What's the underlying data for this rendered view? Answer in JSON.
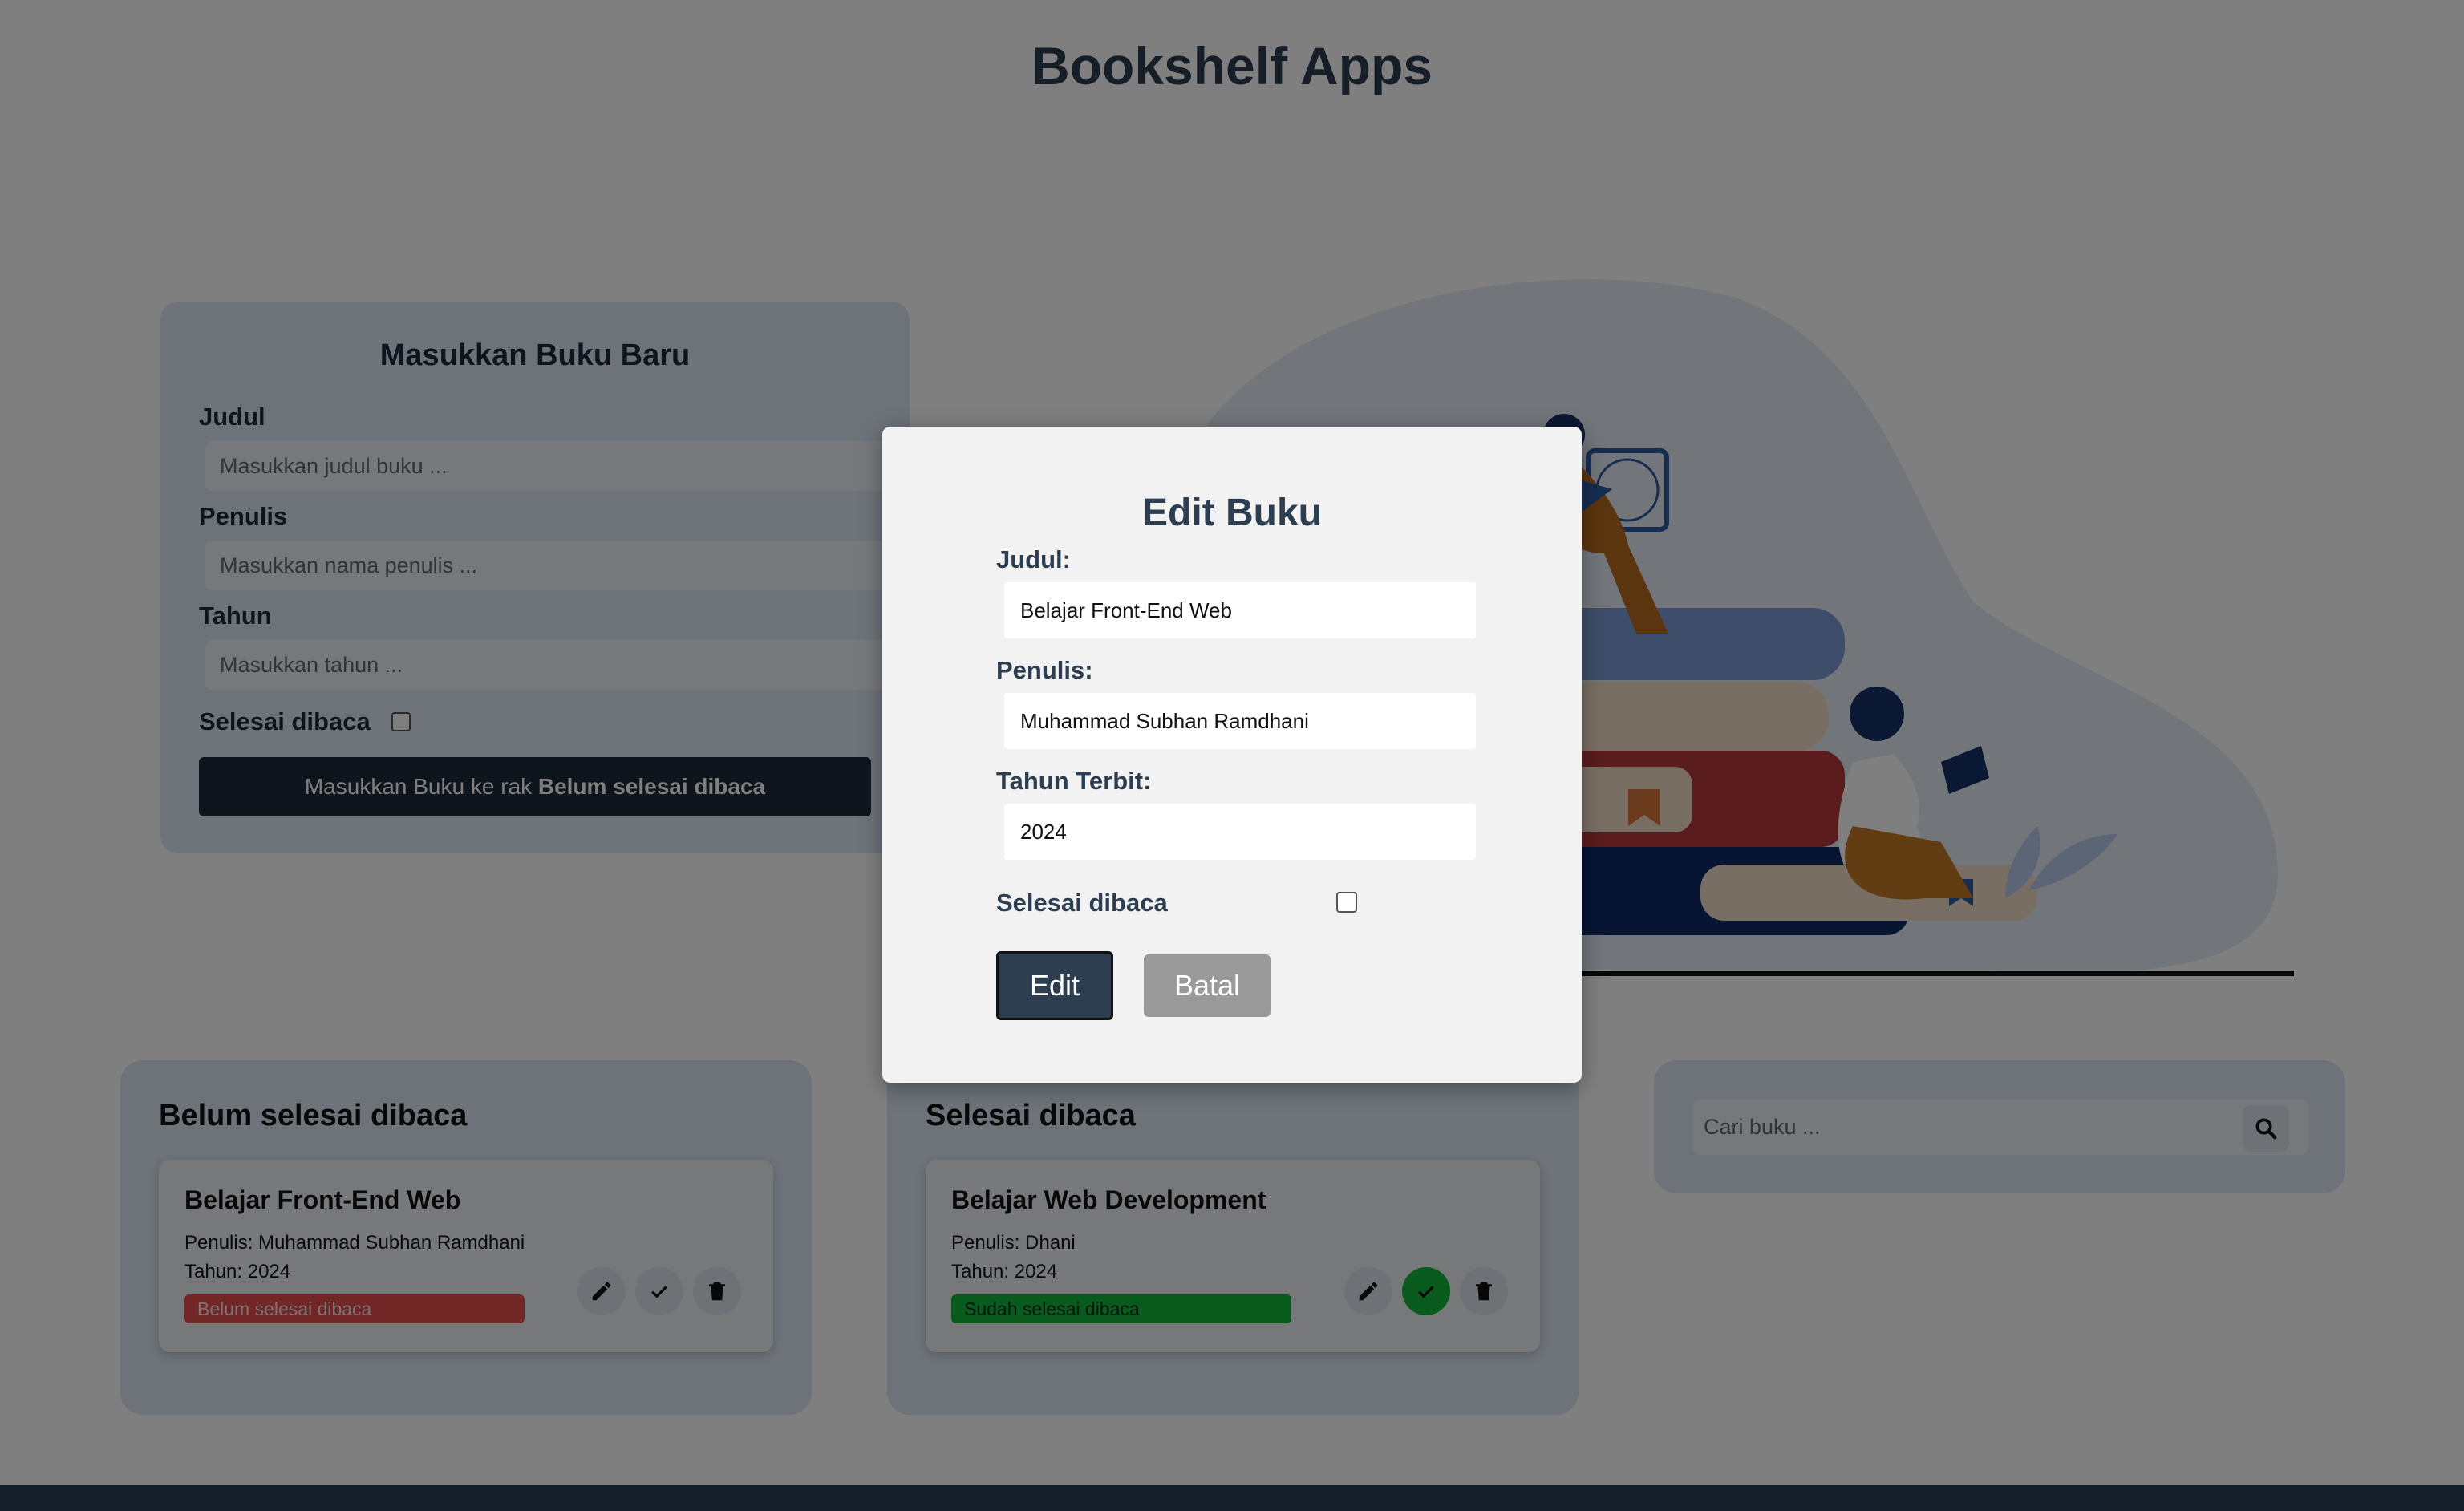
{
  "app": {
    "title": "Bookshelf Apps"
  },
  "form": {
    "heading": "Masukkan Buku Baru",
    "title_label": "Judul",
    "title_placeholder": "Masukkan judul buku ...",
    "author_label": "Penulis",
    "author_placeholder": "Masukkan nama penulis ...",
    "year_label": "Tahun",
    "year_placeholder": "Masukkan tahun ...",
    "complete_label": "Selesai dibaca",
    "complete_checked": false,
    "submit_prefix": "Masukkan Buku ke rak ",
    "submit_shelf": "Belum selesai dibaca"
  },
  "shelves": {
    "unread": {
      "heading": "Belum selesai dibaca",
      "books": [
        {
          "title": "Belajar Front-End Web",
          "author": "Penulis: Muhammad Subhan Ramdhani",
          "year": "Tahun: 2024",
          "status": "Belum selesai dibaca"
        }
      ]
    },
    "read": {
      "heading": "Selesai dibaca",
      "books": [
        {
          "title": "Belajar Web Development",
          "author": "Penulis: Dhani",
          "year": "Tahun: 2024",
          "status": "Sudah selesai dibaca"
        }
      ]
    }
  },
  "search": {
    "placeholder": "Cari buku ...",
    "icon": "search-icon"
  },
  "modal": {
    "heading": "Edit Buku",
    "title_label": "Judul:",
    "title_value": "Belajar Front-End Web",
    "author_label": "Penulis:",
    "author_value": "Muhammad Subhan Ramdhani",
    "year_label": "Tahun Terbit:",
    "year_value": "2024",
    "complete_label": "Selesai dibaca",
    "complete_checked": false,
    "edit_label": "Edit",
    "cancel_label": "Batal"
  },
  "colors": {
    "primary": "#2d3e50",
    "card_bg": "#dbe6f3",
    "unread_badge": "#e64d4d",
    "read_badge": "#11b53a",
    "footer": "#2a3f55"
  }
}
